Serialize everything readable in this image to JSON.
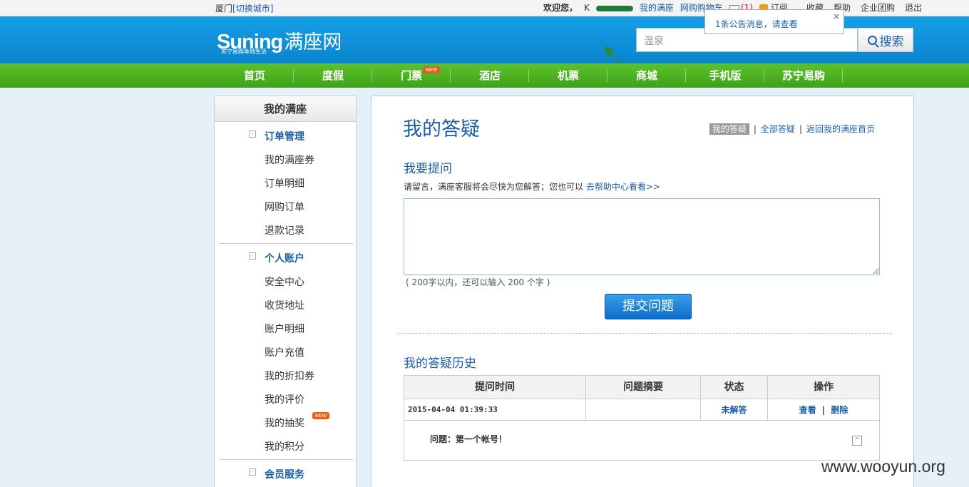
{
  "topbar": {
    "city": "厦门",
    "switch_city": "[切换城市]",
    "welcome": "欢迎您，",
    "user": "K",
    "my_manzuo": "我的满座",
    "cart": "网购购物车",
    "msg_count": "(1)",
    "subscribe": "订阅",
    "favorite": "收藏",
    "help": "帮助",
    "enterprise": "企业团购",
    "logout": "退出"
  },
  "header": {
    "logo_brand": "Suning",
    "logo_name": "满座网",
    "logo_sub": "苏宁易购本地生活",
    "search_placeholder": "温泉",
    "search_button": "搜索",
    "notice_text": "1条公告消息，请查看",
    "notice_close": "×"
  },
  "nav": {
    "items": [
      "首页",
      "度假",
      "门票",
      "酒店",
      "机票",
      "商城",
      "手机版",
      "苏宁易购"
    ],
    "new_badge": "NEW"
  },
  "sidebar": {
    "title": "我的满座",
    "toggle_icon": "-",
    "order_head": "订单管理",
    "order_items": [
      "我的满座券",
      "订单明细",
      "网购订单",
      "退款记录"
    ],
    "account_head": "个人账户",
    "account_items": [
      "安全中心",
      "收货地址",
      "账户明细",
      "账户充值",
      "我的折扣券",
      "我的评价",
      "我的抽奖",
      "我的积分"
    ],
    "member_head": "会员服务",
    "new_badge": "NEW"
  },
  "main": {
    "title": "我的答疑",
    "link_current": "我的答疑",
    "link_all": "全部答疑",
    "link_home": "返回我的满座首页",
    "link_sep": "|",
    "ask_title": "我要提问",
    "hint": "请留言，满座客服将会尽快为您解答；您也可以",
    "hint_link": "去帮助中心看看>>",
    "count": "( 200字以内，还可以输入 200 个字 )",
    "submit": "提交问题",
    "history_title": "我的答疑历史",
    "columns": [
      "提问时间",
      "问题摘要",
      "状态",
      "操作"
    ],
    "row": {
      "time": "2015-04-04 01:39:33",
      "summary": "",
      "status": "未解答",
      "view": "查看",
      "sep": "|",
      "delete": "删除"
    },
    "question": "问题：第一个帐号！",
    "collapse_icon": "^"
  },
  "watermark": "www.wooyun.org"
}
